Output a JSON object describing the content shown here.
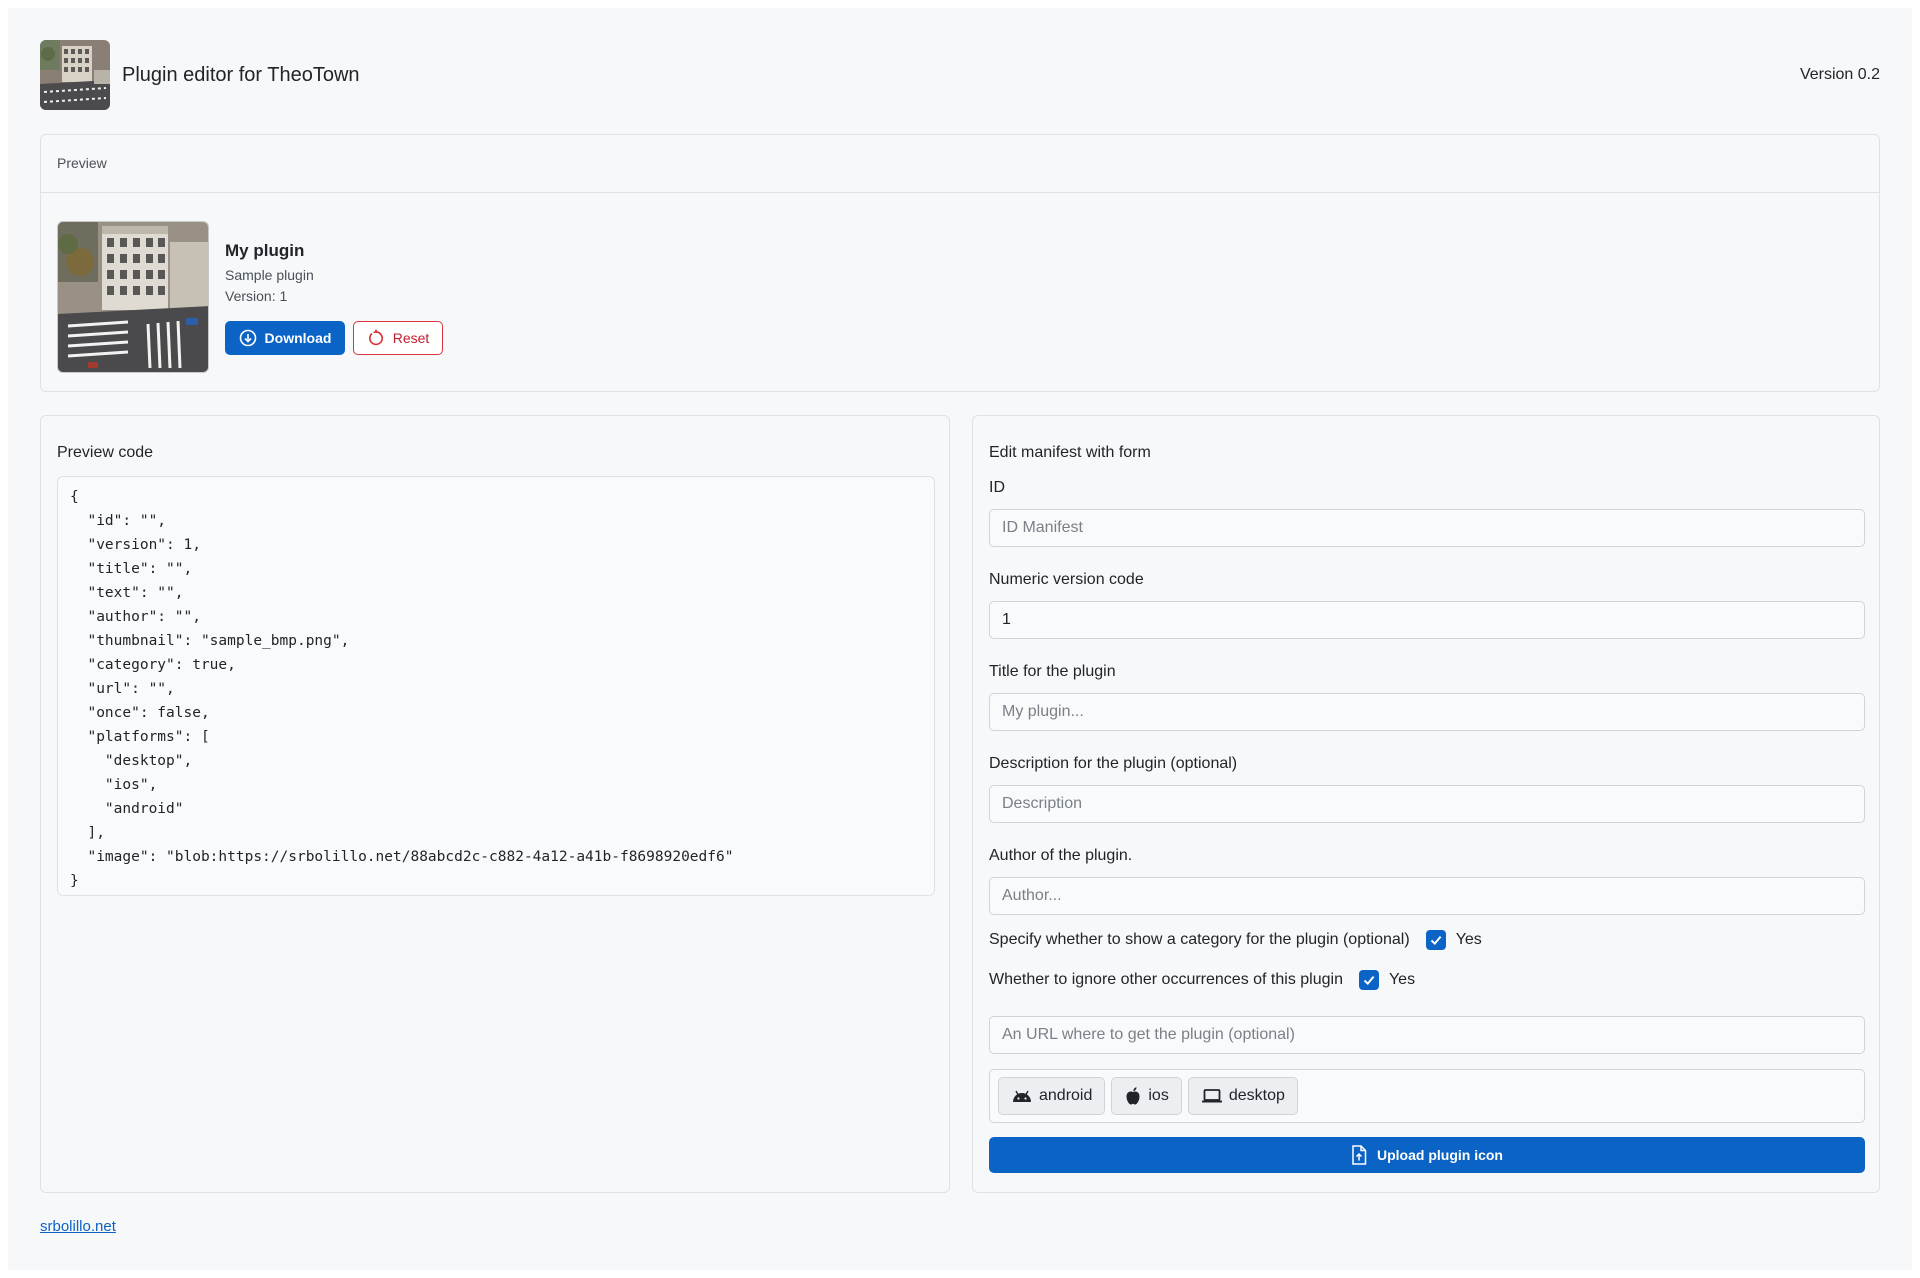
{
  "header": {
    "title": "Plugin editor for TheoTown",
    "version": "Version 0.2",
    "logo_icon": "city-aerial-logo"
  },
  "preview": {
    "heading": "Preview",
    "plugin_title": "My plugin",
    "plugin_subtitle": "Sample plugin",
    "plugin_version": "Version: 1",
    "download_label": "Download",
    "reset_label": "Reset",
    "thumbnail_icon": "city-aerial-thumbnail"
  },
  "code": {
    "heading": "Preview code",
    "content": "{\n  \"id\": \"\",\n  \"version\": 1,\n  \"title\": \"\",\n  \"text\": \"\",\n  \"author\": \"\",\n  \"thumbnail\": \"sample_bmp.png\",\n  \"category\": true,\n  \"url\": \"\",\n  \"once\": false,\n  \"platforms\": [\n    \"desktop\",\n    \"ios\",\n    \"android\"\n  ],\n  \"image\": \"blob:https://srbolillo.net/88abcd2c-c882-4a12-a41b-f8698920edf6\"\n}"
  },
  "form": {
    "heading": "Edit manifest with form",
    "id_label": "ID",
    "id_placeholder": "ID Manifest",
    "id_value": "",
    "version_label": "Numeric version code",
    "version_value": "1",
    "title_label": "Title for the plugin",
    "title_placeholder": "My plugin...",
    "description_label": "Description for the plugin (optional)",
    "description_placeholder": "Description",
    "author_label": "Author of the plugin.",
    "author_placeholder": "Author...",
    "category_label": "Specify whether to show a category for the plugin (optional)",
    "category_checked": true,
    "category_yes": "Yes",
    "once_label": "Whether to ignore other occurrences of this plugin",
    "once_checked": true,
    "once_yes": "Yes",
    "url_placeholder": "An URL where to get the plugin (optional)",
    "platforms": [
      {
        "label": "android",
        "icon": "android-icon"
      },
      {
        "label": "ios",
        "icon": "apple-icon"
      },
      {
        "label": "desktop",
        "icon": "laptop-icon"
      }
    ],
    "upload_label": "Upload plugin icon"
  },
  "footer": {
    "link_text": "srbolillo.net"
  },
  "colors": {
    "primary": "#0b63c6",
    "danger": "#d9363e",
    "background": "#f7f8fa",
    "border": "#dee2e6"
  }
}
